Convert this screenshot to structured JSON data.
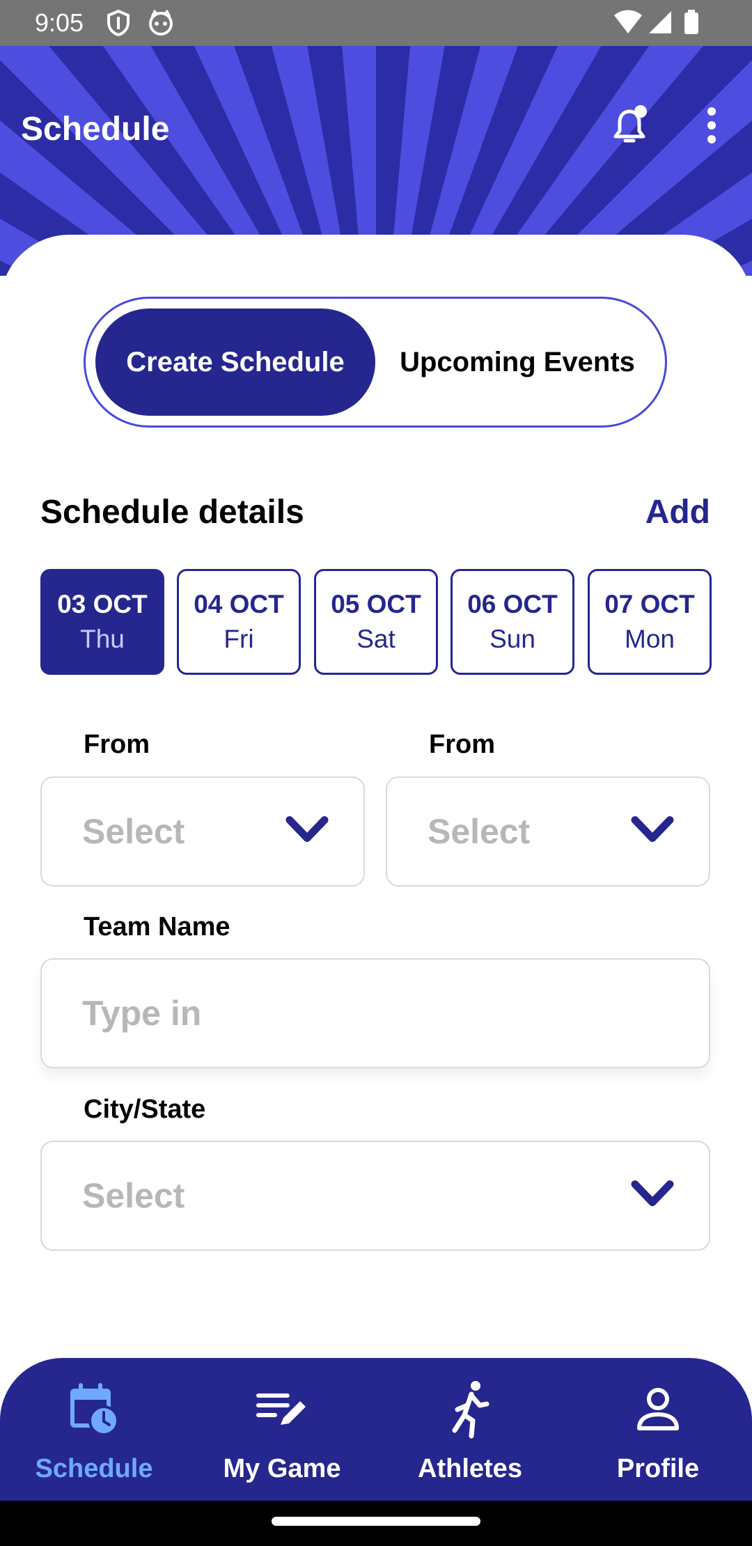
{
  "status": {
    "time": "9:05"
  },
  "header": {
    "title": "Schedule"
  },
  "toggle": {
    "active_label": "Create Schedule",
    "inactive_label": "Upcoming Events"
  },
  "details": {
    "title": "Schedule details",
    "add_label": "Add"
  },
  "dates": [
    {
      "day": "03 OCT",
      "weekday": "Thu",
      "selected": true
    },
    {
      "day": "04 OCT",
      "weekday": "Fri",
      "selected": false
    },
    {
      "day": "05 OCT",
      "weekday": "Sat",
      "selected": false
    },
    {
      "day": "06 OCT",
      "weekday": "Sun",
      "selected": false
    },
    {
      "day": "07 OCT",
      "weekday": "Mon",
      "selected": false
    }
  ],
  "form": {
    "from_left_label": "From",
    "from_left_value": "Select",
    "from_right_label": "From",
    "from_right_value": "Select",
    "team_label": "Team Name",
    "team_placeholder": "Type in",
    "city_label": "City/State",
    "city_value": "Select"
  },
  "nav": [
    {
      "label": "Schedule",
      "icon": "calendar-clock-icon",
      "active": true
    },
    {
      "label": "My Game",
      "icon": "edit-list-icon",
      "active": false
    },
    {
      "label": "Athletes",
      "icon": "running-person-icon",
      "active": false
    },
    {
      "label": "Profile",
      "icon": "person-icon",
      "active": false
    }
  ],
  "colors": {
    "primary": "#26268f",
    "accent": "#4d4de0",
    "nav_active": "#6fa9ff",
    "placeholder": "#b7b7b7"
  }
}
